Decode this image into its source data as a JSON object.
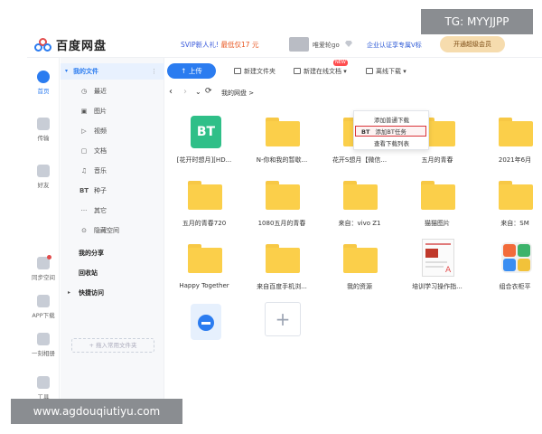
{
  "header": {
    "logo_text": "百度网盘",
    "promo_prefix": "SVIP新人礼! ",
    "promo_price": "最低仅17 元",
    "username": "唯爱轮go",
    "cert": "企业认证享专属V标",
    "upgrade_label": "开通超级会员"
  },
  "rail": [
    {
      "label": "首页"
    },
    {
      "label": "传输"
    },
    {
      "label": "好友"
    },
    {
      "label": "同步空间"
    },
    {
      "label": "APP下载"
    },
    {
      "label": "一刻相册"
    },
    {
      "label": "工具"
    }
  ],
  "tree": {
    "root_label": "我的文件",
    "root_more": "⋮",
    "items": [
      {
        "icon": "◷",
        "label": "最近"
      },
      {
        "icon": "▣",
        "label": "图片"
      },
      {
        "icon": "▷",
        "label": "视频"
      },
      {
        "icon": "▢",
        "label": "文档"
      },
      {
        "icon": "♫",
        "label": "音乐"
      },
      {
        "icon": "BT",
        "label": "种子"
      },
      {
        "icon": "···",
        "label": "其它"
      },
      {
        "icon": "⊙",
        "label": "隐藏空间"
      }
    ],
    "share_label": "我的分享",
    "recycle_label": "回收站",
    "quick_label": "快捷访问",
    "add_quick_label": "+ 拖入常用文件夹",
    "storage_used_fraction": 0.5
  },
  "toolbar": {
    "upload_label": "↑ 上传",
    "new_folder_label": "新建文件夹",
    "new_online_doc_label": "新建在线文档 ▾",
    "new_badge": "NEW",
    "offline_download_label": "离线下载 ▾"
  },
  "nav": {
    "back": "‹",
    "forward": "›",
    "dropdown": "⌄",
    "refresh": "⟳",
    "breadcrumb": "我的网盘  >"
  },
  "dropdown": {
    "items": [
      {
        "label": "添加普通下载",
        "tag": ""
      },
      {
        "label": "添加BT任务",
        "tag": "BT"
      },
      {
        "label": "查看下载列表",
        "tag": ""
      }
    ]
  },
  "files": [
    {
      "kind": "bt",
      "name": "[花开时想月][HD..."
    },
    {
      "kind": "folder",
      "name": "N-你和我的暂歇..."
    },
    {
      "kind": "folder",
      "name": "花开S想月【微信..."
    },
    {
      "kind": "folder",
      "name": "五月的青春"
    },
    {
      "kind": "folder",
      "name": "2021年6月"
    },
    {
      "kind": "folder",
      "name": "五月的青春720"
    },
    {
      "kind": "folder",
      "name": "1080五月的青春"
    },
    {
      "kind": "folder",
      "name": "来自：vivo Z1"
    },
    {
      "kind": "folder",
      "name": "猫猫图片"
    },
    {
      "kind": "folder",
      "name": "来自：SM"
    },
    {
      "kind": "folder",
      "name": "Happy Together"
    },
    {
      "kind": "folder",
      "name": "来自百度手机浏..."
    },
    {
      "kind": "folder",
      "name": "我的资源"
    },
    {
      "kind": "doc",
      "name": "培训学习操作指..."
    },
    {
      "kind": "app",
      "name": "组合衣柜平"
    },
    {
      "kind": "netdisk",
      "name": ""
    },
    {
      "kind": "add",
      "name": ""
    }
  ],
  "bt_text": "BT",
  "pdf_mark": "A",
  "add_tile_text": "+",
  "overlays": {
    "top_right": "TG: MYYJJPP",
    "bottom_left": "www.agdouqiutiyu.com"
  },
  "colors": {
    "accent": "#2b7cf0",
    "folder": "#fbcf4a",
    "bt": "#2fbf88",
    "highlight_border": "#d9343a"
  }
}
